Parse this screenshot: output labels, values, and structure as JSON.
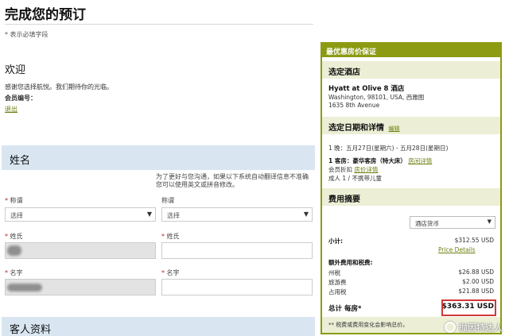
{
  "page": {
    "title": "完成您的预订",
    "required_note": "* 表示必填字段"
  },
  "welcome": {
    "heading": "欢迎",
    "message": "感谢您选择航悦。我们期待你的光临。",
    "member_label": "会员编号：",
    "logout": "退出"
  },
  "name_section": {
    "heading": "姓名",
    "help_note": "为了更好与您沟通，如果以下系统自动翻译信息不准确您可以使用英文或拼音修改。",
    "left": {
      "title_label": "称谓",
      "title_value": "选择",
      "last_name_label": "姓氏",
      "first_name_label": "名字"
    },
    "right": {
      "title_label": "称谓",
      "title_value": "选择",
      "last_name_label": "姓氏",
      "first_name_label": "名字"
    }
  },
  "guest_section": {
    "heading": "客人资料"
  },
  "summary_card": {
    "header": "最优惠房价保证",
    "hotel_section": {
      "heading": "选定酒店",
      "hotel_name": "Hyatt at Olive 8 酒店",
      "address_line1": "Washington, 98101, USA, 西雅图",
      "address_line2": "1635 8th Avenue"
    },
    "dates_section": {
      "heading": "选定日期和详情",
      "edit": "编辑",
      "nights": "1 晚：五月27日(星期六) - 五月28日(星期日)",
      "room_label": "1 客房：豪华客房（特大床）",
      "room_detail": "房间详情",
      "rate_label": "会员折扣",
      "rate_detail": "房价详情",
      "guests": "成人 1 / 不携带儿童"
    },
    "fees_section": {
      "heading": "费用摘要",
      "currency": "酒店货币",
      "subtotal_label": "小计:",
      "subtotal_value": "$312.55 USD",
      "price_details": "Price Details",
      "extra_label": "额外费用和税费:",
      "fees": [
        {
          "label": "州税",
          "value": "$26.88 USD"
        },
        {
          "label": "旅游费",
          "value": "$2.00 USD"
        },
        {
          "label": "占用税",
          "value": "$21.88 USD"
        }
      ],
      "total_label": "总计 每房*",
      "total_value": "$363.31 USD",
      "footnote": "** 税费或费用变化会影响总价。"
    }
  },
  "watermark": " 抛因特达人"
}
